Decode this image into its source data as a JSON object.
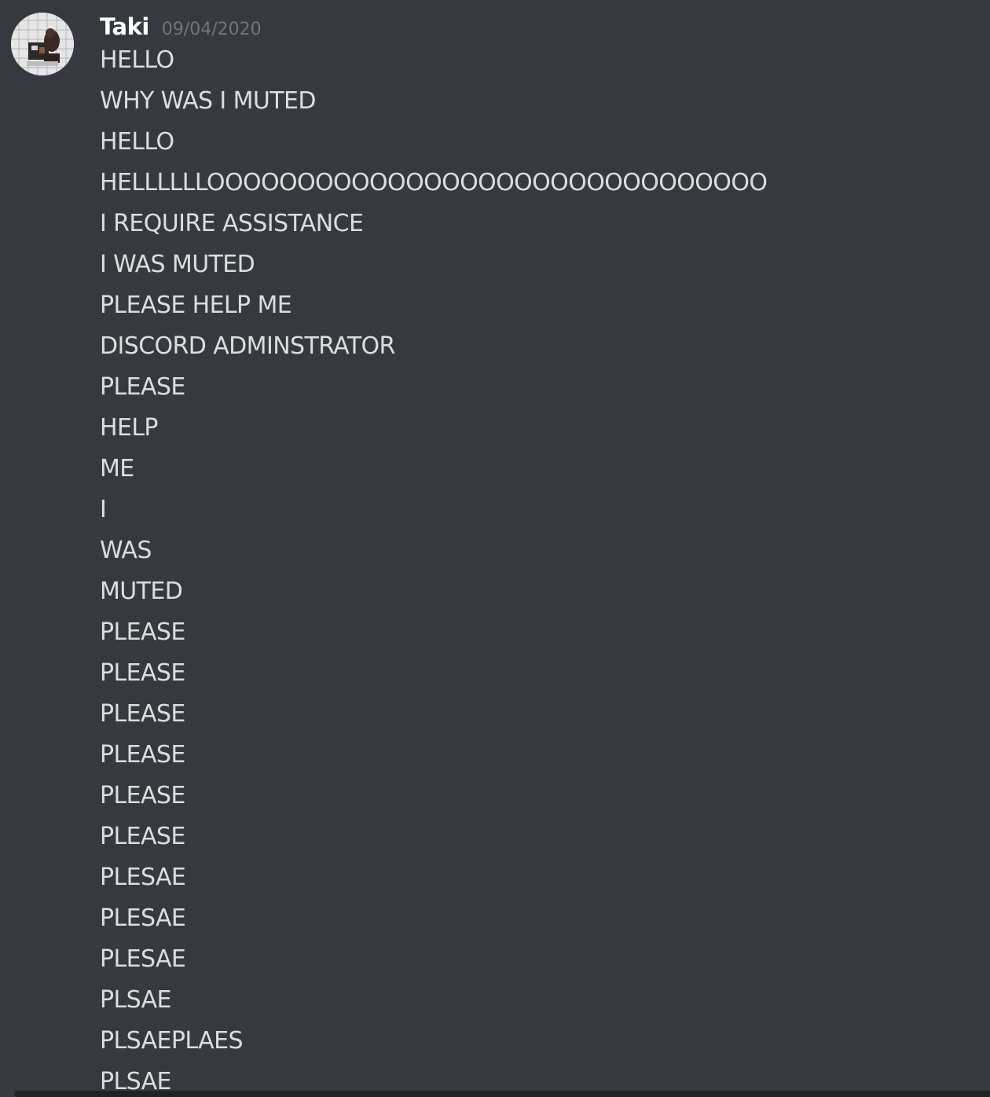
{
  "message_group": {
    "author": {
      "username": "Taki",
      "timestamp": "09/04/2020"
    },
    "messages": [
      "HELLO",
      "WHY WAS I MUTED",
      "HELLO",
      "HELLLLLLOOOOOOOOOOOOOOOOOOOOOOOOOOOOOOO",
      "I REQUIRE ASSISTANCE",
      "I WAS MUTED",
      "PLEASE HELP ME",
      "DISCORD ADMINSTRATOR",
      "PLEASE",
      "HELP",
      "ME",
      "I",
      "WAS",
      "MUTED",
      "PLEASE",
      "PLEASE",
      "PLEASE",
      "PLEASE",
      "PLEASE",
      "PLEASE",
      "PLESAE",
      "PLESAE",
      "PLESAE",
      "PLSAE",
      "PLSAEPLAES",
      "PLSAE"
    ]
  },
  "colors": {
    "background": "#36393f",
    "username": "#ffffff",
    "timestamp": "#72767d",
    "message_text": "#dcddde"
  },
  "icons": {
    "avatar": "user-avatar-image"
  }
}
